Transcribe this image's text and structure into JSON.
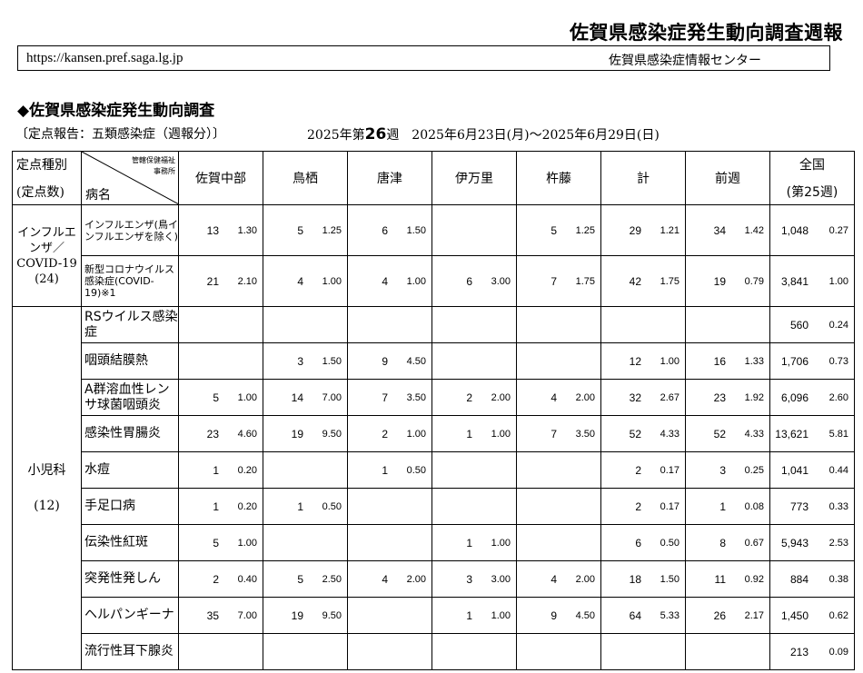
{
  "header": {
    "title": "佐賀県感染症発生動向調査週報",
    "url": "https://kansen.pref.saga.lg.jp",
    "center": "佐賀県感染症情報センター"
  },
  "section": {
    "title": "◆佐賀県感染症発生動向調査",
    "report_type": "〔定点報告：五類感染症（週報分）〕",
    "period_prefix": "2025年第",
    "week": "26",
    "period_suffix": "週　2025年6月23日(月)～2025年6月29日(日)"
  },
  "table": {
    "head": {
      "type_label": "定点種別",
      "count_label": "(定点数)",
      "office_label_1": "管轄保健福祉",
      "office_label_2": "事務所",
      "disease_label": "病名",
      "regions": [
        "佐賀中部",
        "鳥栖",
        "唐津",
        "伊万里",
        "杵藤",
        "計",
        "前週"
      ],
      "national_label": "全国",
      "national_week": "(第25週)"
    },
    "groups": [
      {
        "category": "インフルエンザ／COVID-19",
        "category_count": "(24)",
        "rows": [
          {
            "disease": "インフルエンザ(鳥インフルエンザを除く)",
            "small": true,
            "values": [
              [
                "13",
                "1.30"
              ],
              [
                "5",
                "1.25"
              ],
              [
                "6",
                "1.50"
              ],
              [
                "",
                ""
              ],
              [
                "5",
                "1.25"
              ],
              [
                "29",
                "1.21"
              ],
              [
                "34",
                "1.42"
              ],
              [
                "1,048",
                "0.27"
              ]
            ]
          },
          {
            "disease": "新型コロナウイルス感染症(COVID-19)※1",
            "small": true,
            "values": [
              [
                "21",
                "2.10"
              ],
              [
                "4",
                "1.00"
              ],
              [
                "4",
                "1.00"
              ],
              [
                "6",
                "3.00"
              ],
              [
                "7",
                "1.75"
              ],
              [
                "42",
                "1.75"
              ],
              [
                "19",
                "0.79"
              ],
              [
                "3,841",
                "1.00"
              ]
            ]
          }
        ]
      },
      {
        "category": "小児科",
        "category_count": "(12)",
        "rows": [
          {
            "disease": "RSウイルス感染症",
            "values": [
              [
                "",
                ""
              ],
              [
                "",
                ""
              ],
              [
                "",
                ""
              ],
              [
                "",
                ""
              ],
              [
                "",
                ""
              ],
              [
                "",
                ""
              ],
              [
                "",
                ""
              ],
              [
                "560",
                "0.24"
              ]
            ]
          },
          {
            "disease": "咽頭結膜熱",
            "values": [
              [
                "",
                ""
              ],
              [
                "3",
                "1.50"
              ],
              [
                "9",
                "4.50"
              ],
              [
                "",
                ""
              ],
              [
                "",
                ""
              ],
              [
                "12",
                "1.00"
              ],
              [
                "16",
                "1.33"
              ],
              [
                "1,706",
                "0.73"
              ]
            ]
          },
          {
            "disease": "A群溶血性レンサ球菌咽頭炎",
            "values": [
              [
                "5",
                "1.00"
              ],
              [
                "14",
                "7.00"
              ],
              [
                "7",
                "3.50"
              ],
              [
                "2",
                "2.00"
              ],
              [
                "4",
                "2.00"
              ],
              [
                "32",
                "2.67"
              ],
              [
                "23",
                "1.92"
              ],
              [
                "6,096",
                "2.60"
              ]
            ]
          },
          {
            "disease": "感染性胃腸炎",
            "values": [
              [
                "23",
                "4.60"
              ],
              [
                "19",
                "9.50"
              ],
              [
                "2",
                "1.00"
              ],
              [
                "1",
                "1.00"
              ],
              [
                "7",
                "3.50"
              ],
              [
                "52",
                "4.33"
              ],
              [
                "52",
                "4.33"
              ],
              [
                "13,621",
                "5.81"
              ]
            ]
          },
          {
            "disease": "水痘",
            "values": [
              [
                "1",
                "0.20"
              ],
              [
                "",
                ""
              ],
              [
                "1",
                "0.50"
              ],
              [
                "",
                ""
              ],
              [
                "",
                ""
              ],
              [
                "2",
                "0.17"
              ],
              [
                "3",
                "0.25"
              ],
              [
                "1,041",
                "0.44"
              ]
            ]
          },
          {
            "disease": "手足口病",
            "values": [
              [
                "1",
                "0.20"
              ],
              [
                "1",
                "0.50"
              ],
              [
                "",
                ""
              ],
              [
                "",
                ""
              ],
              [
                "",
                ""
              ],
              [
                "2",
                "0.17"
              ],
              [
                "1",
                "0.08"
              ],
              [
                "773",
                "0.33"
              ]
            ]
          },
          {
            "disease": "伝染性紅斑",
            "values": [
              [
                "5",
                "1.00"
              ],
              [
                "",
                ""
              ],
              [
                "",
                ""
              ],
              [
                "1",
                "1.00"
              ],
              [
                "",
                ""
              ],
              [
                "6",
                "0.50"
              ],
              [
                "8",
                "0.67"
              ],
              [
                "5,943",
                "2.53"
              ]
            ]
          },
          {
            "disease": "突発性発しん",
            "values": [
              [
                "2",
                "0.40"
              ],
              [
                "5",
                "2.50"
              ],
              [
                "4",
                "2.00"
              ],
              [
                "3",
                "3.00"
              ],
              [
                "4",
                "2.00"
              ],
              [
                "18",
                "1.50"
              ],
              [
                "11",
                "0.92"
              ],
              [
                "884",
                "0.38"
              ]
            ]
          },
          {
            "disease": "ヘルパンギーナ",
            "values": [
              [
                "35",
                "7.00"
              ],
              [
                "19",
                "9.50"
              ],
              [
                "",
                ""
              ],
              [
                "1",
                "1.00"
              ],
              [
                "9",
                "4.50"
              ],
              [
                "64",
                "5.33"
              ],
              [
                "26",
                "2.17"
              ],
              [
                "1,450",
                "0.62"
              ]
            ]
          },
          {
            "disease": "流行性耳下腺炎",
            "values": [
              [
                "",
                ""
              ],
              [
                "",
                ""
              ],
              [
                "",
                ""
              ],
              [
                "",
                ""
              ],
              [
                "",
                ""
              ],
              [
                "",
                ""
              ],
              [
                "",
                ""
              ],
              [
                "213",
                "0.09"
              ]
            ]
          }
        ]
      }
    ]
  }
}
